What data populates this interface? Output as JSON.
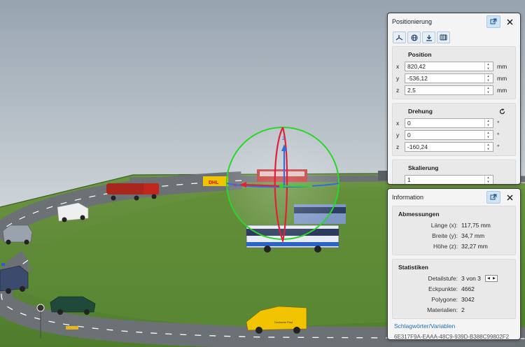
{
  "positioning": {
    "title": "Positionierung",
    "tools": [
      "axes-icon",
      "globe-icon",
      "drop-to-floor-icon",
      "grid-icon"
    ],
    "position": {
      "title": "Position",
      "x_label": "x",
      "x_value": "820,42",
      "x_unit": "mm",
      "y_label": "y",
      "y_value": "-536,12",
      "y_unit": "mm",
      "z_label": "z",
      "z_value": "2,5",
      "z_unit": "mm"
    },
    "rotation": {
      "title": "Drehung",
      "x_label": "x",
      "x_value": "0",
      "x_unit": "°",
      "y_label": "y",
      "y_value": "0",
      "y_unit": "°",
      "z_label": "z",
      "z_value": "-160,24",
      "z_unit": "°"
    },
    "scaling": {
      "title": "Skalierung",
      "value": "1"
    }
  },
  "information": {
    "title": "Information",
    "dimensions": {
      "title": "Abmessungen",
      "length_label": "Länge (x):",
      "length_value": "117,75 mm",
      "width_label": "Breite (y):",
      "width_value": "34,7 mm",
      "height_label": "Höhe (z):",
      "height_value": "32,27 mm"
    },
    "statistics": {
      "title": "Statistiken",
      "detail_label": "Detailstufe:",
      "detail_value": "3 von 3",
      "vertices_label": "Eckpunkte:",
      "vertices_value": "4662",
      "polygons_label": "Polygone:",
      "polygons_value": "3042",
      "materials_label": "Materialien:",
      "materials_value": "2"
    },
    "link": "Schlagwörter/Variablen",
    "guid": "6E317F9A-EAAA-48C9-939D-B388C99802F2"
  },
  "viewport": {
    "gizmo_x": "x",
    "gizmo_z": "z",
    "truck_label": "DHL",
    "van_label": "Deutsche Post"
  },
  "colors": {
    "sky_top": "#9aa7b2",
    "sky_bottom": "#e6eaec",
    "grass": "#5c8a34",
    "road": "#6f7378",
    "gizmo_red": "#e2203a",
    "gizmo_green": "#2bd62b",
    "gizmo_blue": "#2f6fe0",
    "accent_blue": "#1a6fb8"
  }
}
